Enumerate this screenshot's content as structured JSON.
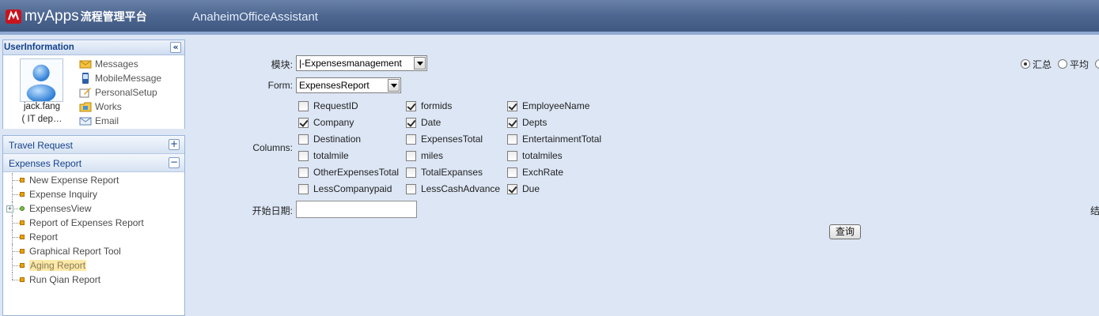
{
  "header": {
    "brand_name": "myApps",
    "brand_sub": "流程管理平台",
    "app_title": "AnaheimOfficeAssistant"
  },
  "user_panel": {
    "title": "UserInformation",
    "collapse_glyph": "«",
    "name_line1": "jack.fang",
    "name_line2": "( IT dep…",
    "links": [
      {
        "label": "Messages",
        "icon": "envelope-icon"
      },
      {
        "label": "MobileMessage",
        "icon": "mobile-icon"
      },
      {
        "label": "PersonalSetup",
        "icon": "edit-icon"
      },
      {
        "label": "Works",
        "icon": "folder-icon"
      },
      {
        "label": "Email",
        "icon": "mail-icon"
      }
    ]
  },
  "nav": {
    "sections": [
      {
        "label": "Travel Request",
        "toggle": "+"
      },
      {
        "label": "Expenses Report",
        "toggle": "−"
      }
    ],
    "items": [
      {
        "label": "New Expense Report"
      },
      {
        "label": "Expense Inquiry"
      },
      {
        "label": "ExpensesView",
        "expand": "+"
      },
      {
        "label": "Report of Expenses Report"
      },
      {
        "label": "Report"
      },
      {
        "label": "Graphical Report Tool"
      },
      {
        "label": "Aging Report",
        "selected": true
      },
      {
        "label": "Run Qian Report"
      }
    ]
  },
  "form": {
    "module_label": "模块:",
    "module_value": "|-Expensesmanagement",
    "form_label": "Form:",
    "form_value": "ExpensesReport",
    "columns_label": "Columns:",
    "columns": [
      [
        {
          "label": "RequestID",
          "checked": false
        },
        {
          "label": "formids",
          "checked": true
        },
        {
          "label": "EmployeeName",
          "checked": true
        }
      ],
      [
        {
          "label": "Company",
          "checked": true
        },
        {
          "label": "Date",
          "checked": true
        },
        {
          "label": "Depts",
          "checked": true
        }
      ],
      [
        {
          "label": "Destination",
          "checked": false
        },
        {
          "label": "ExpensesTotal",
          "checked": false
        },
        {
          "label": "EntertainmentTotal",
          "checked": false
        }
      ],
      [
        {
          "label": "totalmile",
          "checked": false
        },
        {
          "label": "miles",
          "checked": false
        },
        {
          "label": "totalmiles",
          "checked": false
        }
      ],
      [
        {
          "label": "OtherExpensesTotal",
          "checked": false
        },
        {
          "label": "TotalExpanses",
          "checked": false
        },
        {
          "label": "ExchRate",
          "checked": false
        }
      ],
      [
        {
          "label": "LessCompanypaid",
          "checked": false
        },
        {
          "label": "LessCashAdvance",
          "checked": false
        },
        {
          "label": "Due",
          "checked": true
        }
      ]
    ],
    "start_date_label": "开始日期:",
    "start_date_value": "",
    "end_date_label_partial": "结",
    "query_button": "查询",
    "radios": [
      {
        "label": "汇总",
        "checked": true
      },
      {
        "label": "平均",
        "checked": false
      }
    ]
  }
}
